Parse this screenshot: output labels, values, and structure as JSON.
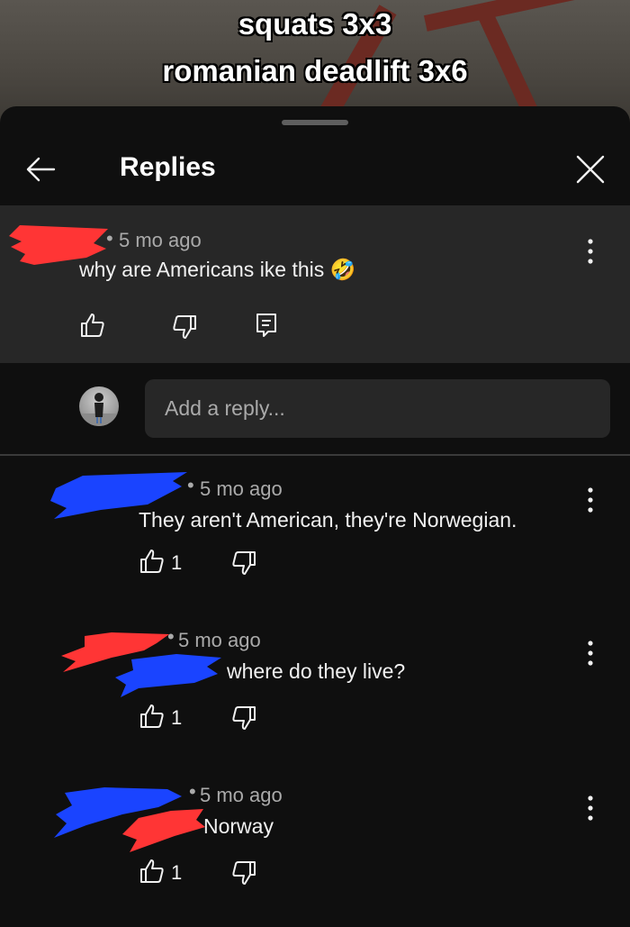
{
  "video": {
    "caption_lines": [
      "squats 3x3",
      "romanian deadlift 3x6"
    ]
  },
  "header": {
    "title": "Replies",
    "back_icon": "arrow-left-icon",
    "close_icon": "close-icon"
  },
  "parent_comment": {
    "time": "5 mo ago",
    "text": "why are Americans ike this 🤣"
  },
  "reply_input": {
    "placeholder": "Add a reply..."
  },
  "replies": [
    {
      "time": "5 mo ago",
      "text": "They aren't American, they're Norwegian.",
      "likes": "1"
    },
    {
      "time": "5 mo ago",
      "text": "where do they live?",
      "likes": "1"
    },
    {
      "time": "5 mo ago",
      "text": "Norway",
      "likes": "1"
    }
  ],
  "colors": {
    "background": "#0f0f0f",
    "highlight": "#272727",
    "secondary_text": "#aaaaaa",
    "redact_red": "#ff3535",
    "redact_blue": "#1a44ff"
  }
}
